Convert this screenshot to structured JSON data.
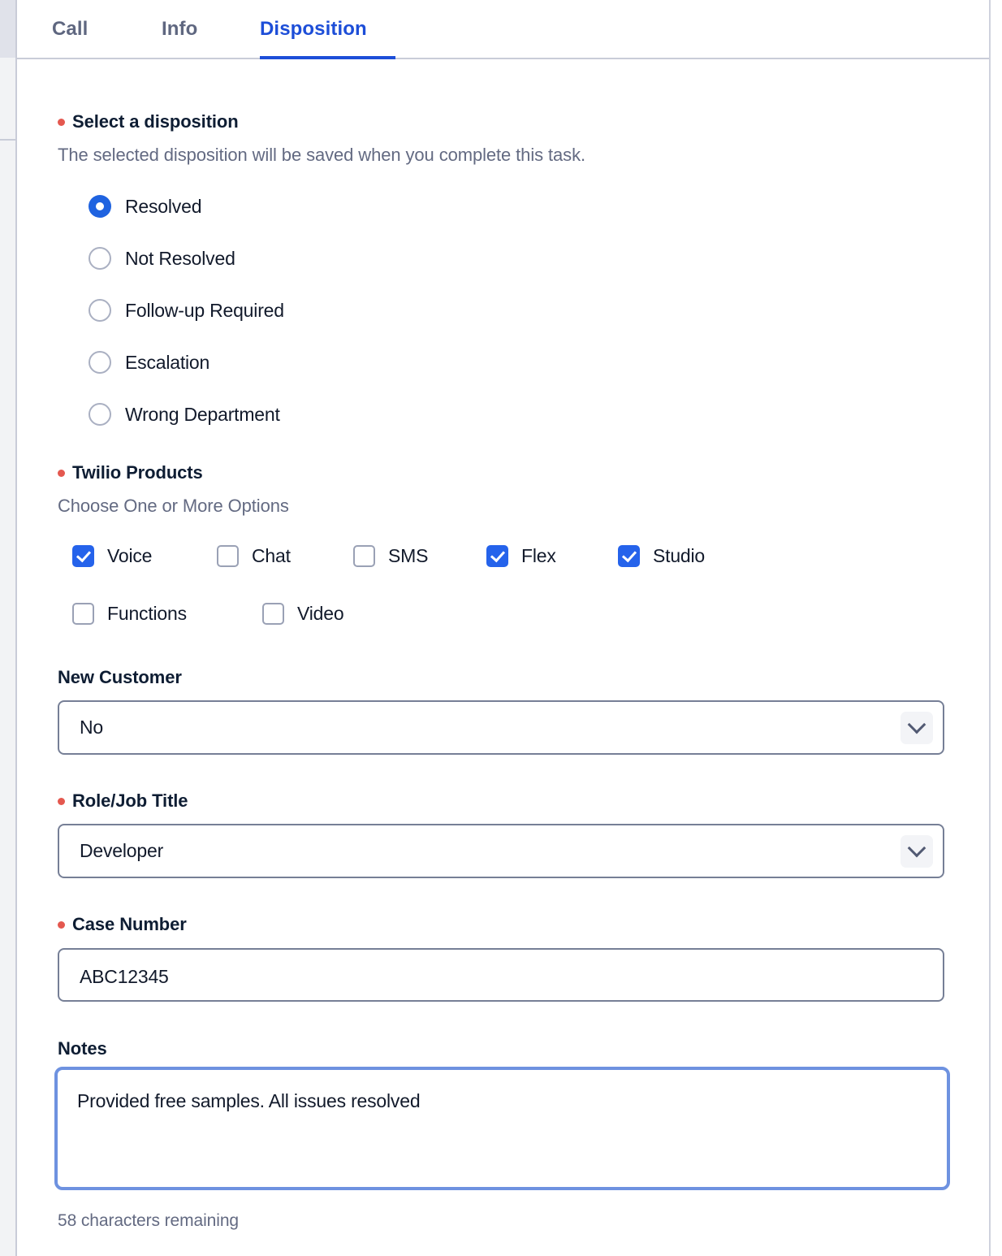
{
  "tabs": [
    {
      "label": "Call",
      "active": false
    },
    {
      "label": "Info",
      "active": false
    },
    {
      "label": "Disposition",
      "active": true
    }
  ],
  "disposition": {
    "label": "Select a disposition",
    "required": true,
    "help": "The selected disposition will be saved when you complete this task.",
    "options": [
      {
        "label": "Resolved",
        "checked": true
      },
      {
        "label": "Not Resolved",
        "checked": false
      },
      {
        "label": "Follow-up Required",
        "checked": false
      },
      {
        "label": "Escalation",
        "checked": false
      },
      {
        "label": "Wrong Department",
        "checked": false
      }
    ]
  },
  "products": {
    "label": "Twilio Products",
    "required": true,
    "help": "Choose One or More Options",
    "options": [
      {
        "label": "Voice",
        "checked": true
      },
      {
        "label": "Chat",
        "checked": false
      },
      {
        "label": "SMS",
        "checked": false
      },
      {
        "label": "Flex",
        "checked": true
      },
      {
        "label": "Studio",
        "checked": true
      },
      {
        "label": "Functions",
        "checked": false
      },
      {
        "label": "Video",
        "checked": false
      }
    ]
  },
  "new_customer": {
    "label": "New Customer",
    "required": false,
    "value": "No"
  },
  "role": {
    "label": "Role/Job Title",
    "required": true,
    "value": "Developer"
  },
  "case_number": {
    "label": "Case Number",
    "required": true,
    "value": "ABC12345"
  },
  "notes": {
    "label": "Notes",
    "required": false,
    "value": "Provided free samples. All issues resolved",
    "counter": "58 characters remaining"
  },
  "colors": {
    "accent": "#1d4ed8",
    "checkbox": "#2563eb",
    "radio": "#1f63e0",
    "required_dot": "#e4584f",
    "focus_ring": "#6e92e0",
    "text": "#121a2b",
    "muted": "#636a82",
    "border": "#767f96"
  }
}
